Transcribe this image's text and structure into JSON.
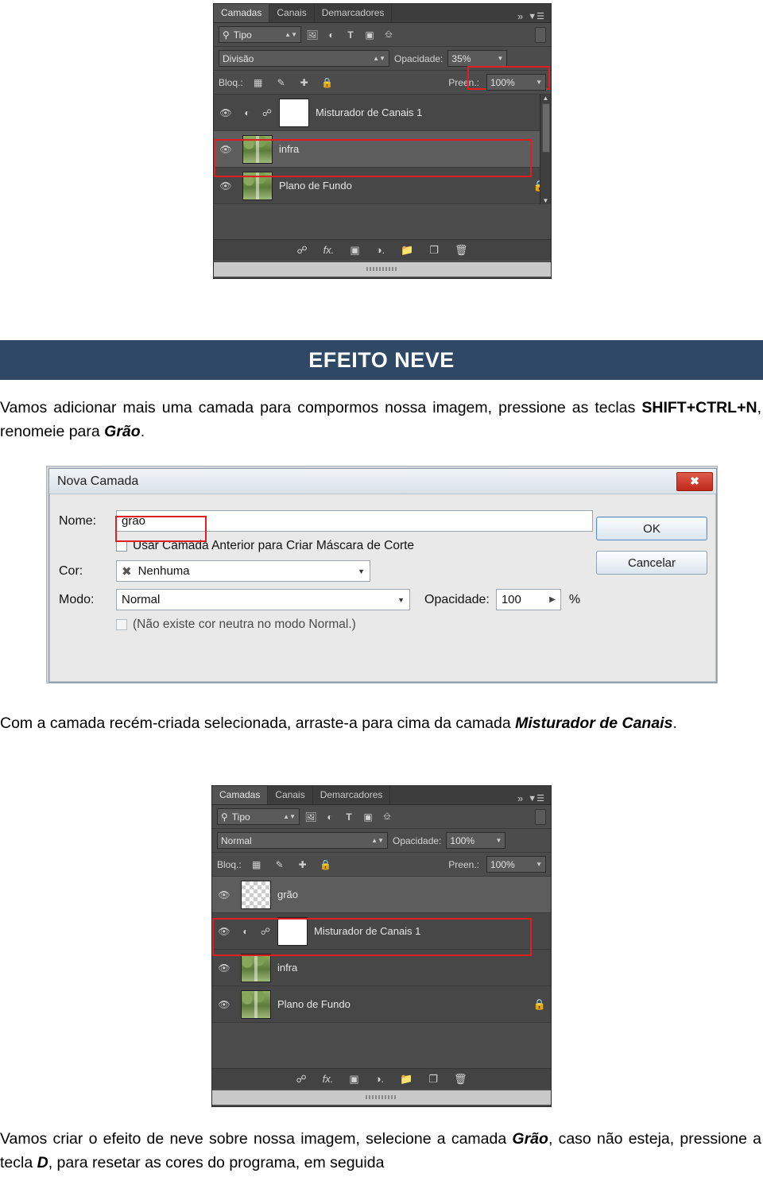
{
  "panel_top": {
    "tabs": [
      {
        "label": "Camadas",
        "active": true
      },
      {
        "label": "Canais",
        "active": false
      },
      {
        "label": "Demarcadores",
        "active": false
      }
    ],
    "filter_label": "Tipo",
    "blend_mode": "Divisão",
    "opacity_label": "Opacidade:",
    "opacity_value": "35%",
    "lock_label": "Bloq.:",
    "fill_label": "Preen.:",
    "fill_value": "100%",
    "layers": [
      {
        "name": "Misturador de Canais 1",
        "thumb": "white",
        "visible": true,
        "selected": false,
        "linked": true,
        "locked": false
      },
      {
        "name": "infra",
        "thumb": "forest",
        "visible": true,
        "selected": true,
        "linked": false,
        "locked": false
      },
      {
        "name": "Plano de Fundo",
        "thumb": "forest",
        "visible": true,
        "selected": false,
        "linked": false,
        "locked": true
      }
    ],
    "footer_icons": [
      "link-icon",
      "fx-icon",
      "mask-icon",
      "adjustment-icon",
      "folder-icon",
      "new-layer-icon",
      "trash-icon"
    ]
  },
  "banner": {
    "title": "EFEITO NEVE"
  },
  "paragraph1": {
    "part1": "Vamos adicionar mais uma camada para compormos nossa imagem, pressione as teclas ",
    "bold1": "SHIFT+CTRL+N",
    "part2": ", renomeie para ",
    "bold2": "Grão",
    "part3": "."
  },
  "dialog": {
    "title": "Nova Camada",
    "close_icon": "close-icon",
    "name_label": "Nome:",
    "name_value": "grão",
    "checkbox1_label": "Usar Camada Anterior para Criar Máscara de Corte",
    "color_label": "Cor:",
    "color_value": "Nenhuma",
    "mode_label": "Modo:",
    "mode_value": "Normal",
    "opacity_label": "Opacidade:",
    "opacity_value": "100",
    "percent": "%",
    "note": "(Não existe cor neutra no modo Normal.)",
    "ok_label": "OK",
    "cancel_label": "Cancelar"
  },
  "paragraph2": {
    "part1": "Com a camada recém-criada selecionada, arraste-a para cima da camada ",
    "bold1": "Misturador de Canais",
    "part2": "."
  },
  "panel_bottom": {
    "tabs": [
      {
        "label": "Camadas",
        "active": true
      },
      {
        "label": "Canais",
        "active": false
      },
      {
        "label": "Demarcadores",
        "active": false
      }
    ],
    "filter_label": "Tipo",
    "blend_mode": "Normal",
    "opacity_label": "Opacidade:",
    "opacity_value": "100%",
    "lock_label": "Bloq.:",
    "fill_label": "Preen.:",
    "fill_value": "100%",
    "layers": [
      {
        "name": "grão",
        "thumb": "checker",
        "visible": true,
        "selected": true,
        "linked": false,
        "locked": false
      },
      {
        "name": "Misturador de Canais 1",
        "thumb": "white",
        "visible": true,
        "selected": false,
        "linked": true,
        "locked": false
      },
      {
        "name": "infra",
        "thumb": "forest",
        "visible": true,
        "selected": false,
        "linked": false,
        "locked": false
      },
      {
        "name": "Plano de Fundo",
        "thumb": "forest",
        "visible": true,
        "selected": false,
        "linked": false,
        "locked": true
      }
    ]
  },
  "paragraph3": {
    "part1": "Vamos criar o efeito de neve sobre nossa imagem, selecione a camada ",
    "bold1": "Grão",
    "part2": ", caso não esteja, pressione a tecla ",
    "bold2": "D",
    "part3": ", para resetar as cores do programa, em seguida"
  },
  "colors": {
    "banner_bg": "#2e4865",
    "highlight_red": "#e02020",
    "panel_bg": "#4c4c4c"
  }
}
